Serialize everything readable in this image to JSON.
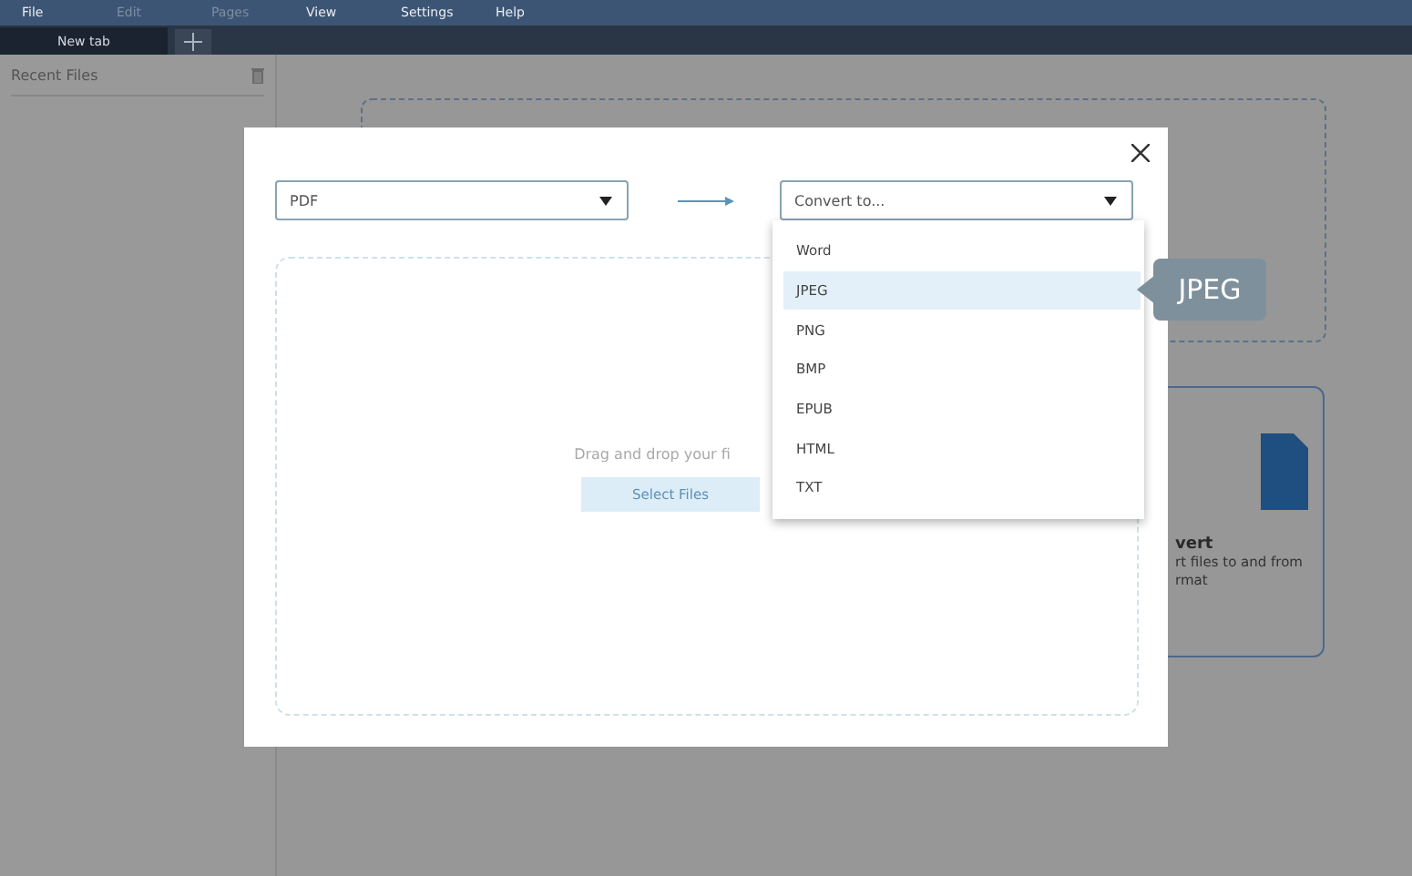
{
  "menu": [
    {
      "label": "File",
      "disabled": false
    },
    {
      "label": "Edit",
      "disabled": true
    },
    {
      "label": "Pages",
      "disabled": true
    },
    {
      "label": "View",
      "disabled": false
    },
    {
      "label": "Settings",
      "disabled": false
    },
    {
      "label": "Help",
      "disabled": false
    }
  ],
  "tabs": [
    {
      "label": "New tab",
      "selected": true
    }
  ],
  "sidebar": {
    "title": "Recent Files"
  },
  "background_card": {
    "title": "vert",
    "description": "rt files to and from",
    "description_2": "rmat"
  },
  "dialog": {
    "source": {
      "value": "PDF"
    },
    "target": {
      "placeholder": "Convert to...",
      "options": [
        {
          "label": "Word",
          "selected": false
        },
        {
          "label": "JPEG",
          "selected": true
        },
        {
          "label": "PNG",
          "selected": false
        },
        {
          "label": "BMP",
          "selected": false
        },
        {
          "label": "EPUB",
          "selected": false
        },
        {
          "label": "HTML",
          "selected": false
        },
        {
          "label": "TXT",
          "selected": false
        }
      ]
    },
    "drop_hint": "Drag and drop your fi",
    "select_button": "Select Files"
  },
  "callout": "JPEG"
}
